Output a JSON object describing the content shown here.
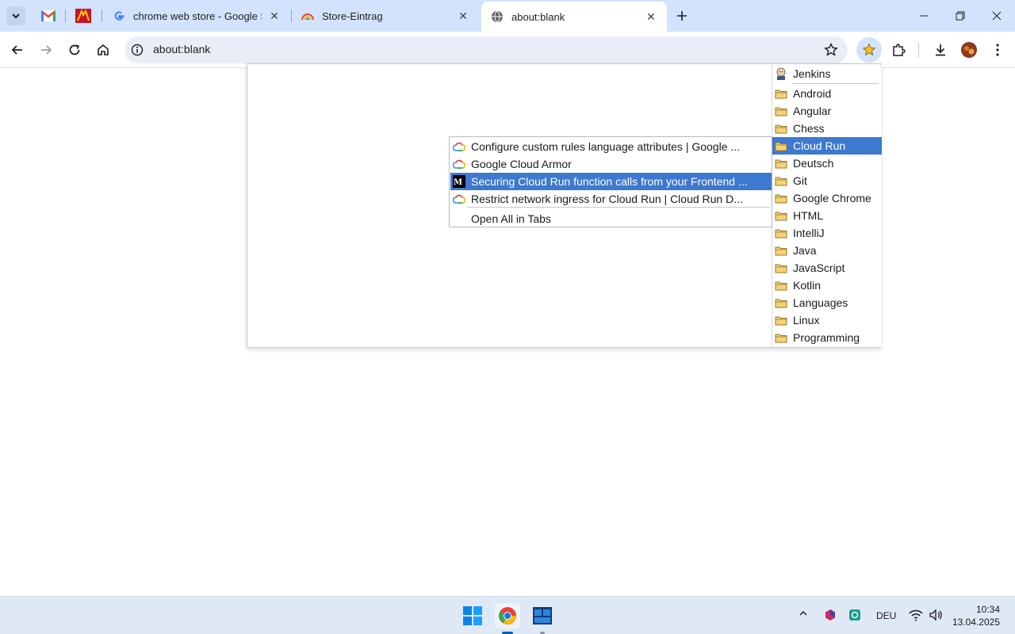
{
  "browser": {
    "tabs": [
      {
        "title": "chrome web store - Google Suche",
        "favicon": "google-g-icon"
      },
      {
        "title": "Store-Eintrag",
        "favicon": "rainbow-icon"
      },
      {
        "title": "about:blank",
        "favicon": "globe-icon",
        "active": true
      }
    ],
    "address": "about:blank"
  },
  "bookmarks": {
    "top_item": "Jenkins",
    "folders": [
      "Android",
      "Angular",
      "Chess",
      "Cloud Run",
      "Deutsch",
      "Git",
      "Google Chrome",
      "HTML",
      "IntelliJ",
      "Java",
      "JavaScript",
      "Kotlin",
      "Languages",
      "Linux",
      "Programming"
    ],
    "selected_folder": "Cloud Run",
    "submenu": [
      "Configure custom rules language attributes  |  Google ...",
      "Google Cloud Armor",
      "Securing Cloud Run function calls from your Frontend ...",
      "Restrict network ingress for Cloud Run  |  Cloud Run D..."
    ],
    "open_all": "Open All in Tabs"
  },
  "taskbar": {
    "language": "DEU",
    "time": "10:34",
    "date": "13.04.2025"
  },
  "colors": {
    "tabstrip": "#d3e3fd",
    "selection": "#3d79cf",
    "taskbar": "#dfe9f5"
  }
}
